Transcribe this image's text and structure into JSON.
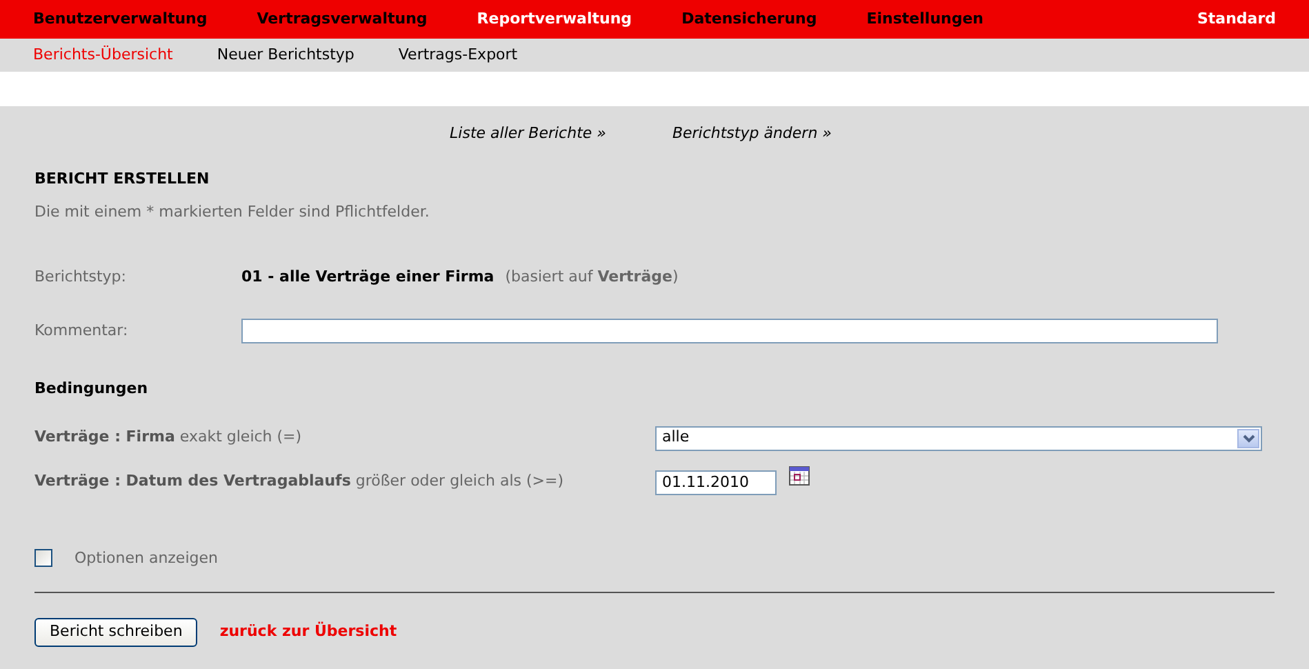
{
  "main_nav": [
    {
      "label": "Benutzerverwaltung",
      "selected": false
    },
    {
      "label": "Vertragsverwaltung",
      "selected": false
    },
    {
      "label": "Reportverwaltung",
      "selected": true
    },
    {
      "label": "Datensicherung",
      "selected": false
    },
    {
      "label": "Einstellungen",
      "selected": false
    }
  ],
  "user_menu": "Standard",
  "sub_nav": [
    {
      "label": "Berichts-Übersicht",
      "selected": true
    },
    {
      "label": "Neuer Berichtstyp",
      "selected": false
    },
    {
      "label": "Vertrags-Export",
      "selected": false
    }
  ],
  "links": [
    "Liste aller Berichte »",
    "Berichtstyp ändern »"
  ],
  "heading": "BERICHT ERSTELLEN",
  "hint": "Die mit einem * markierten Felder sind Pflichtfelder.",
  "report_type": {
    "label": "Berichtstyp:",
    "value": "01 - alle Verträge einer Firma",
    "note": "(basiert auf **Verträge**)"
  },
  "comment": {
    "label": "Kommentar:"
  },
  "conditions_heading": "Bedingungen",
  "conditions": [
    {
      "kind": "select",
      "label": "**Verträge : Firma** exakt gleich (=)",
      "value": "alle"
    },
    {
      "kind": "date",
      "label": "**Verträge : Datum des Vertragablaufs** größer oder gleich als (>=)",
      "value": "01.11.2010"
    }
  ],
  "show_options": {
    "label": "Optionen anzeigen",
    "checked": false
  },
  "submit": "Bericht schreiben",
  "back_link": "zurück zur Übersicht"
}
